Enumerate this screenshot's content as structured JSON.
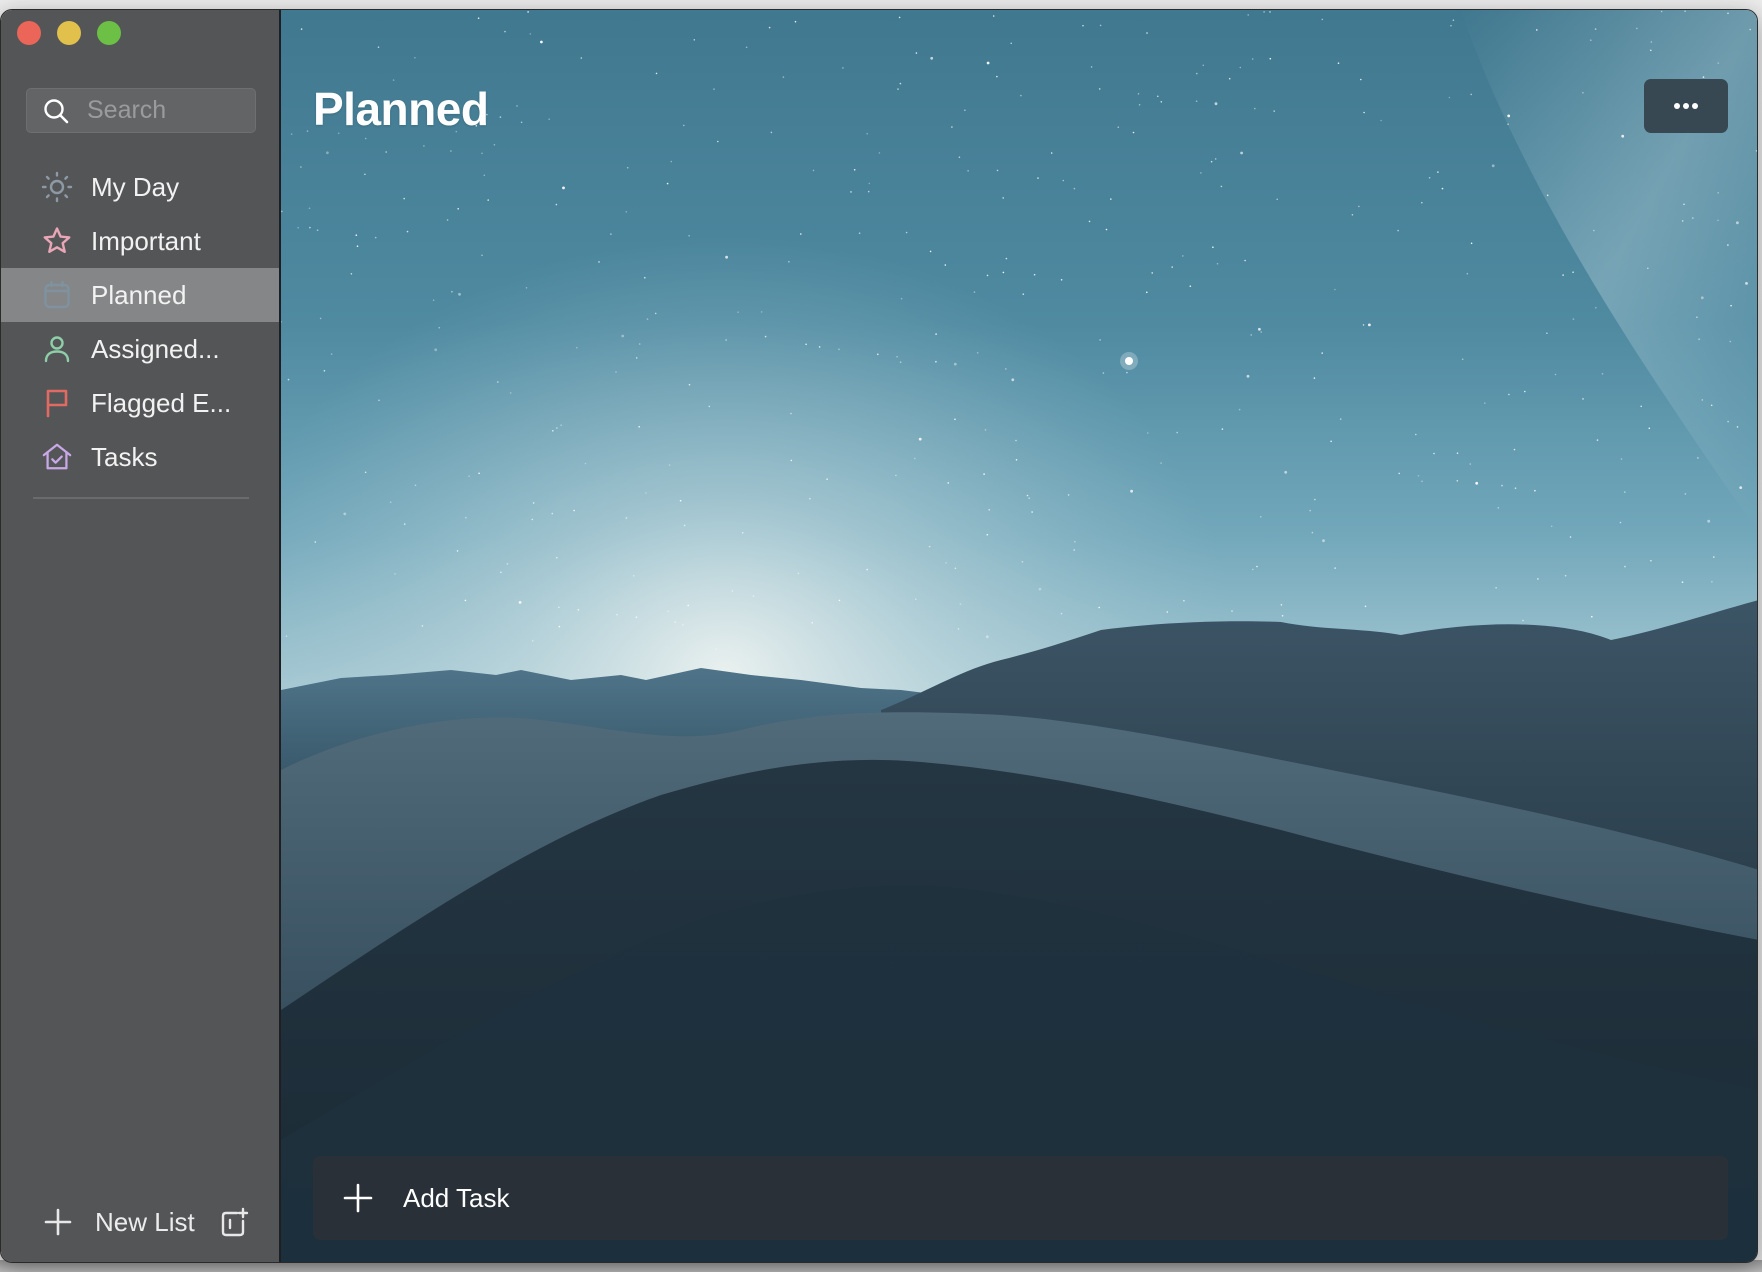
{
  "window": {
    "controls": [
      "close",
      "minimize",
      "zoom"
    ]
  },
  "sidebar": {
    "search": {
      "placeholder": "Search",
      "value": "",
      "icon": "search-icon"
    },
    "items": [
      {
        "label": "My Day",
        "icon": "sun-icon",
        "color": "#8d9aa6",
        "active": false
      },
      {
        "label": "Important",
        "icon": "star-icon",
        "color": "#e8a6b6",
        "active": false
      },
      {
        "label": "Planned",
        "icon": "calendar-icon",
        "color": "#7f929f",
        "active": true
      },
      {
        "label": "Assigned...",
        "icon": "person-icon",
        "color": "#8ecfa9",
        "active": false
      },
      {
        "label": "Flagged E...",
        "icon": "flag-icon",
        "color": "#e06b63",
        "active": false
      },
      {
        "label": "Tasks",
        "icon": "home-check-icon",
        "color": "#c9a8e6",
        "active": false
      }
    ],
    "new_list": {
      "label": "New List",
      "icon": "plus-icon",
      "group_icon": "new-group-icon"
    }
  },
  "main": {
    "title": "Planned",
    "more_button": {
      "icon": "ellipsis-icon",
      "label": "More options"
    },
    "add_task": {
      "placeholder": "Add Task",
      "value": "",
      "icon": "plus-icon"
    },
    "background": "night-desert-dunes"
  }
}
